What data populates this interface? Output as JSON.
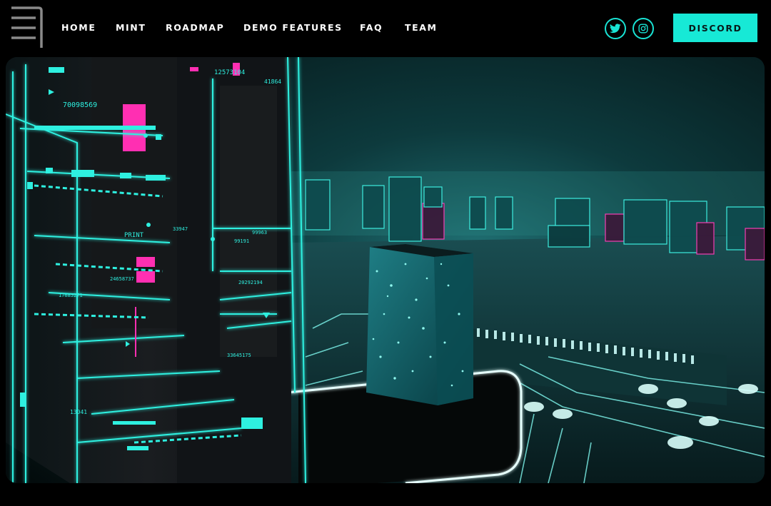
{
  "nav": {
    "links": [
      "HOME",
      "MINT",
      "ROADMAP",
      "DEMO FEATURES",
      "FAQ",
      "TEAM"
    ],
    "social": [
      "twitter-icon",
      "instagram-icon"
    ],
    "discord_label": "DISCORD"
  },
  "hero": {
    "hud_labels": [
      "70098569",
      "12573104",
      "41864",
      "PRINT",
      "33947",
      "99963",
      "99191",
      "20292194",
      "24658737",
      "17685271",
      "33645175",
      "13041"
    ]
  },
  "colors": {
    "accent": "#17e9d6",
    "magenta": "#ff2fb2",
    "background": "#000000"
  }
}
